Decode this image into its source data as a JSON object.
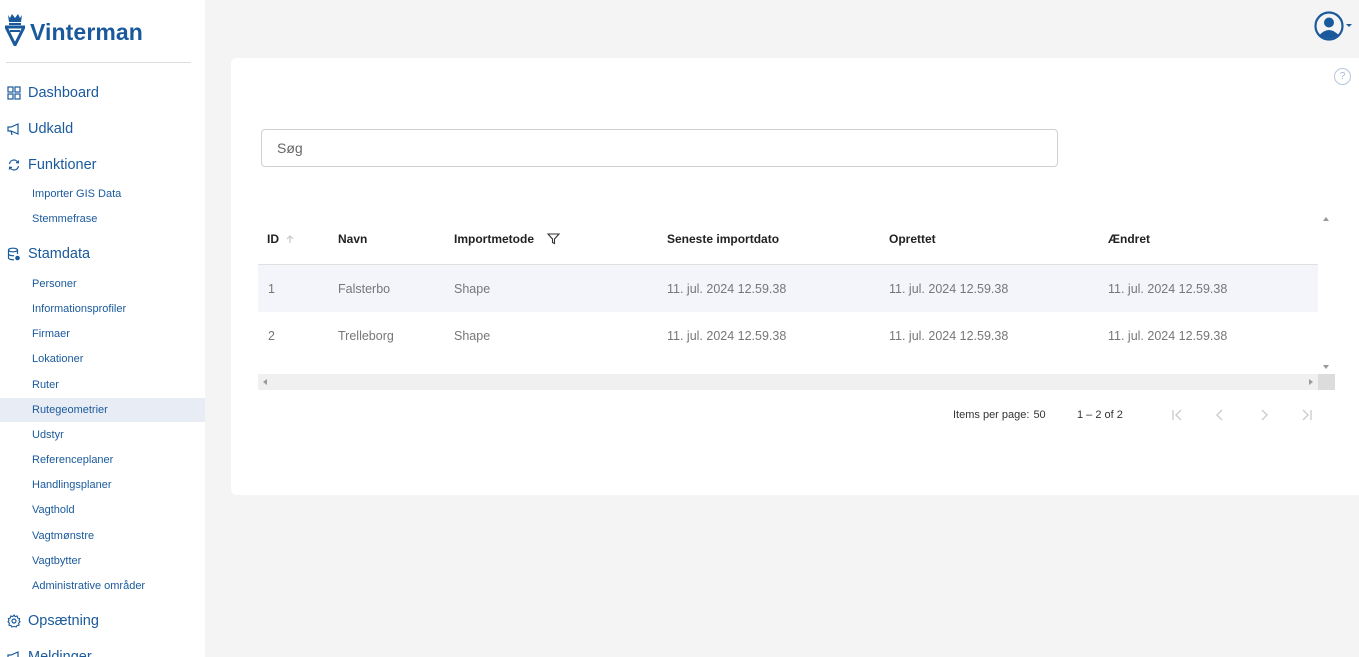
{
  "app": {
    "name": "Vinterman"
  },
  "colors": {
    "brand": "#1a5a9c",
    "active_bg": "#e8edf5",
    "page_bg": "#f4f4f4"
  },
  "sidebar": {
    "sections": [
      {
        "label": "Dashboard",
        "icon": "grid-icon"
      },
      {
        "label": "Udkald",
        "icon": "megaphone-icon"
      },
      {
        "label": "Funktioner",
        "icon": "refresh-icon"
      },
      {
        "label": "Stamdata",
        "icon": "database-icon"
      },
      {
        "label": "Opsætning",
        "icon": "gear-icon"
      },
      {
        "label": "Meldinger",
        "icon": "megaphone-icon"
      }
    ],
    "funktioner_items": [
      "Importer GIS Data",
      "Stemmefrase"
    ],
    "stamdata_items": [
      "Personer",
      "Informationsprofiler",
      "Firmaer",
      "Lokationer",
      "Ruter",
      "Rutegeometrier",
      "Udstyr",
      "Referenceplaner",
      "Handlingsplaner",
      "Vagthold",
      "Vagtmønstre",
      "Vagtbytter",
      "Administrative områder"
    ],
    "active_item": "Rutegeometrier"
  },
  "header": {
    "user_icon": "user-circle-icon"
  },
  "main": {
    "help_label": "?",
    "search": {
      "placeholder": "Søg",
      "value": ""
    },
    "table": {
      "columns": [
        "ID",
        "Navn",
        "Importmetode",
        "Seneste importdato",
        "Oprettet",
        "Ændret"
      ],
      "sort_column": "ID",
      "filter_column": "Importmetode",
      "rows": [
        [
          "1",
          "Falsterbo",
          "Shape",
          "11. jul. 2024 12.59.38",
          "11. jul. 2024 12.59.38",
          "11. jul. 2024 12.59.38"
        ],
        [
          "2",
          "Trelleborg",
          "Shape",
          "11. jul. 2024 12.59.38",
          "11. jul. 2024 12.59.38",
          "11. jul. 2024 12.59.38"
        ]
      ]
    },
    "paginator": {
      "items_per_page_label": "Items per page:",
      "items_per_page": "50",
      "range_label": "1 – 2 of 2"
    }
  }
}
